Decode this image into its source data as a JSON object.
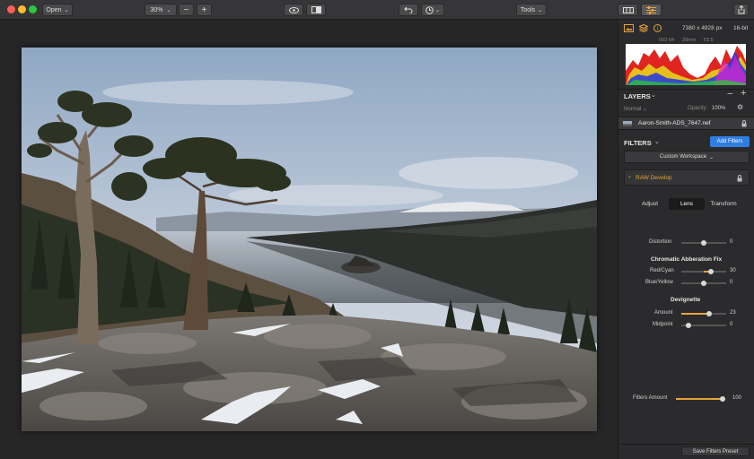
{
  "toolbar": {
    "open_label": "Open",
    "zoom_value": "30%",
    "tools_label": "Tools"
  },
  "info": {
    "dimensions": "7380 x 4928 px",
    "bitdepth": "16-bit",
    "iso": "ISO 64",
    "focal": "20mm",
    "aperture": "f/2.5"
  },
  "layers": {
    "title": "LAYERS",
    "blend": "Normal",
    "opacity_label": "Opacity:",
    "opacity_value": "100%",
    "layer_name": "Aaron-Smith-ADS_7647.nef"
  },
  "filters": {
    "title": "FILTERS",
    "add_label": "Add Filters",
    "workspace": "Custom Workspace",
    "raw_label": "RAW Develop",
    "tabs": [
      "Adjust",
      "Lens",
      "Transform"
    ],
    "active_tab": "Lens",
    "distortion": {
      "label": "Distortion",
      "value": "0",
      "level": 0.5
    },
    "cab_title": "Chromatic Abberation Fix",
    "red_cyan": {
      "label": "Red/Cyan",
      "value": "30",
      "level": 0.65
    },
    "blue_yellow": {
      "label": "Blue/Yellow",
      "value": "0",
      "level": 0.5
    },
    "devignette_title": "Devignette",
    "amount": {
      "label": "Amount",
      "value": "23",
      "level": 0.62
    },
    "midpoint": {
      "label": "Midpoint",
      "value": "0",
      "level": 0.1
    },
    "filters_amount": {
      "label": "Filters Amount",
      "value": "100",
      "level": 1.0
    },
    "save_preset": "Save Filters Preset"
  },
  "colors": {
    "accent": "#e6a33b",
    "add_button": "#2f7de1"
  }
}
